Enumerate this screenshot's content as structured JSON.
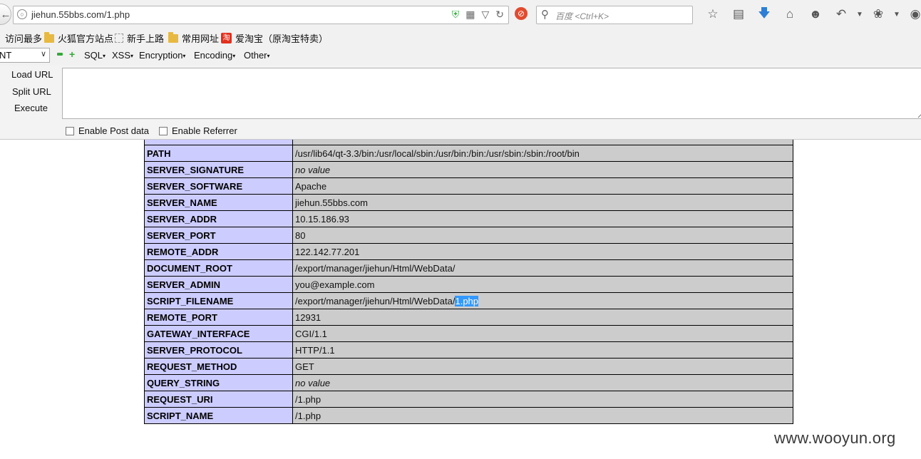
{
  "browser": {
    "url": "jiehun.55bbs.com/1.php",
    "search_placeholder": "百度 <Ctrl+K>",
    "bookmarks": [
      "访问最多",
      "火狐官方站点",
      "新手上路",
      "常用网址",
      "爱淘宝（原淘宝特卖）"
    ]
  },
  "hackbar": {
    "select_value": "NT",
    "menus": [
      "SQL",
      "XSS",
      "Encryption",
      "Encoding",
      "Other"
    ],
    "actions": [
      "Load URL",
      "Split URL",
      "Execute"
    ],
    "checkboxes": [
      "Enable Post data",
      "Enable Referrer"
    ],
    "textarea_value": ""
  },
  "env_table": {
    "rows": [
      {
        "key": "PATH",
        "value": "/usr/lib64/qt-3.3/bin:/usr/local/sbin:/usr/bin:/bin:/usr/sbin:/sbin:/root/bin"
      },
      {
        "key": "SERVER_SIGNATURE",
        "value": "no value"
      },
      {
        "key": "SERVER_SOFTWARE",
        "value": "Apache"
      },
      {
        "key": "SERVER_NAME",
        "value": "jiehun.55bbs.com"
      },
      {
        "key": "SERVER_ADDR",
        "value": "10.15.186.93"
      },
      {
        "key": "SERVER_PORT",
        "value": "80"
      },
      {
        "key": "REMOTE_ADDR",
        "value": "122.142.77.201"
      },
      {
        "key": "DOCUMENT_ROOT",
        "value": "/export/manager/jiehun/Html/WebData/"
      },
      {
        "key": "SERVER_ADMIN",
        "value": "you@example.com"
      },
      {
        "key": "SCRIPT_FILENAME",
        "value": "/export/manager/jiehun/Html/WebData/",
        "highlight": "1.php"
      },
      {
        "key": "REMOTE_PORT",
        "value": "12931"
      },
      {
        "key": "GATEWAY_INTERFACE",
        "value": "CGI/1.1"
      },
      {
        "key": "SERVER_PROTOCOL",
        "value": "HTTP/1.1"
      },
      {
        "key": "REQUEST_METHOD",
        "value": "GET"
      },
      {
        "key": "QUERY_STRING",
        "value": "no value"
      },
      {
        "key": "REQUEST_URI",
        "value": "/1.php"
      },
      {
        "key": "SCRIPT_NAME",
        "value": "/1.php"
      }
    ]
  },
  "watermark": "www.wooyun.org"
}
